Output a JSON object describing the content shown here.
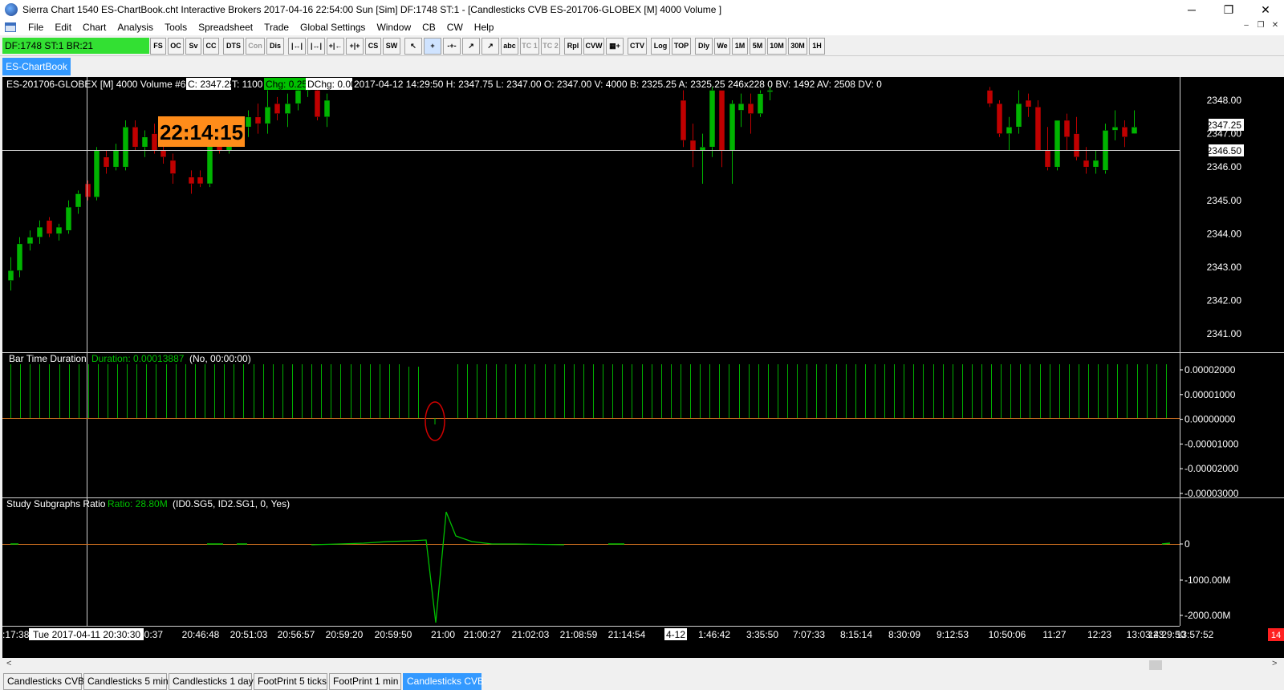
{
  "window": {
    "title": "Sierra Chart 1540 ES-ChartBook.cht  Interactive Brokers 2017-04-16  22:54:00 Sun [Sim]  DF:1748  ST:1 - [Candlesticks CVB  ES-201706-GLOBEX [M]  4000 Volume  ]",
    "controls": [
      "─",
      "❐",
      "✕"
    ]
  },
  "menu": [
    "File",
    "Edit",
    "Chart",
    "Analysis",
    "Tools",
    "Spreadsheet",
    "Trade",
    "Global Settings",
    "Window",
    "CB",
    "CW",
    "Help"
  ],
  "mdi_controls": [
    "–",
    "❐",
    "✕"
  ],
  "toolbar": {
    "status": "DF:1748  ST:1  BR:21",
    "buttons": [
      "FS",
      "OC",
      "Sv",
      "CC",
      "DTS",
      "Con",
      "Dis",
      "|↔|",
      "|↔|",
      "+|←",
      "+|+",
      "CS",
      "SW",
      "↖",
      "+",
      "-+-",
      "↗",
      "↗",
      "abc",
      "TC 1",
      "TC 2",
      "Rpl",
      "CVW",
      "▦+",
      "CTV",
      "Log",
      "TOP",
      "Dly",
      "We",
      "1M",
      "5M",
      "10M",
      "30M",
      "1H"
    ]
  },
  "chartbook_tab": "ES-ChartBook",
  "price_pane": {
    "header_symbol": "ES-201706-GLOBEX [M]  4000 Volume  #6",
    "header_close": "C: 2347.25",
    "header_t": "T: 1100",
    "header_chg": "Chg: 0.25",
    "header_dchg": "DChg: 0.00",
    "header_rest": "2017-04-12 14:29:50 H: 2347.75 L: 2347.00 O: 2347.00 V: 4000 B: 2325.25 A: 2325.25 246x228 0 BV: 1492 AV: 2508 DV: 0",
    "time_badge": "22:14:15",
    "current_price": "2347.25",
    "cursor_price": "2346.50",
    "y_labels": [
      "2348.00",
      "2347.00",
      "2346.00",
      "2345.00",
      "2344.00",
      "2343.00",
      "2342.00",
      "2341.00"
    ]
  },
  "duration_pane": {
    "title": "Bar Time Duration",
    "value": "Duration: 0.00013887",
    "params": "(No, 00:00:00)",
    "y_labels": [
      "0.00002000",
      "0.00001000",
      "0.00000000",
      "-0.00001000",
      "-0.00002000",
      "-0.00003000"
    ]
  },
  "ratio_pane": {
    "title": "Study Subgraphs Ratio",
    "value": "Ratio: 28.80M",
    "params": "(ID0.SG5, ID2.SG1, 0, Yes)",
    "y_labels": [
      "0",
      "-1000.00M",
      "-2000.00M"
    ]
  },
  "time_axis": {
    "labels": [
      ":17:38",
      "0:40:37",
      "20:46:48",
      "20:51:03",
      "20:56:57",
      "20:59:20",
      "20:59:50",
      "21:00",
      "21:00:27",
      "21:02:03",
      "21:08:59",
      "21:14:54",
      "4-12",
      "1:46:42",
      "3:35:50",
      "7:07:33",
      "8:15:14",
      "8:30:09",
      "9:12:53",
      "10:50:06",
      "11:27",
      "12:23",
      "13:03:23",
      "13:57:52",
      "14:29:50"
    ],
    "cursor_label": "Tue 2017-04-11  20:30:30",
    "corner_badge": "14"
  },
  "scroll": {
    "left_arrow": "<",
    "right_arrow": ">"
  },
  "bottom_tabs": [
    "Candlesticks CVB",
    "Candlesticks 5 min",
    "Candlesticks 1 day",
    "FootPrint 5 ticks",
    "FootPrint 1 min",
    "Candlesticks CVB"
  ],
  "colors": {
    "up": "#00b400",
    "down": "#c00000",
    "accent": "#3399ff",
    "badge": "#ff8c1a"
  },
  "chart_data": {
    "type": "candlestick",
    "candles": [
      {
        "o": 2342.6,
        "h": 2343.3,
        "l": 2342.3,
        "c": 2342.9
      },
      {
        "o": 2342.9,
        "h": 2343.9,
        "l": 2342.7,
        "c": 2343.7
      },
      {
        "o": 2343.7,
        "h": 2344.1,
        "l": 2343.5,
        "c": 2343.9
      },
      {
        "o": 2343.9,
        "h": 2344.4,
        "l": 2343.7,
        "c": 2344.2
      },
      {
        "o": 2344.4,
        "h": 2344.5,
        "l": 2343.9,
        "c": 2344.0
      },
      {
        "o": 2344.0,
        "h": 2344.3,
        "l": 2343.8,
        "c": 2344.2
      },
      {
        "o": 2344.1,
        "h": 2345.0,
        "l": 2344.0,
        "c": 2344.8
      },
      {
        "o": 2344.8,
        "h": 2345.3,
        "l": 2344.6,
        "c": 2345.2
      },
      {
        "o": 2345.5,
        "h": 2345.6,
        "l": 2345.0,
        "c": 2345.1
      },
      {
        "o": 2345.1,
        "h": 2346.6,
        "l": 2345.0,
        "c": 2346.5
      },
      {
        "o": 2346.3,
        "h": 2346.5,
        "l": 2345.8,
        "c": 2346.0
      },
      {
        "o": 2346.0,
        "h": 2346.7,
        "l": 2345.9,
        "c": 2346.5
      },
      {
        "o": 2346.0,
        "h": 2347.4,
        "l": 2345.9,
        "c": 2347.2
      },
      {
        "o": 2347.2,
        "h": 2347.4,
        "l": 2346.5,
        "c": 2346.6
      },
      {
        "o": 2346.6,
        "h": 2347.1,
        "l": 2346.3,
        "c": 2346.9
      },
      {
        "o": 2347.0,
        "h": 2347.3,
        "l": 2346.4,
        "c": 2346.5
      },
      {
        "o": 2346.5,
        "h": 2346.7,
        "l": 2346.1,
        "c": 2346.3
      },
      {
        "o": 2346.2,
        "h": 2346.4,
        "l": 2345.5,
        "c": 2345.8
      },
      {
        "o": 2345.7,
        "h": 2345.9,
        "l": 2345.2,
        "c": 2345.5
      },
      {
        "o": 2345.7,
        "h": 2345.9,
        "l": 2345.4,
        "c": 2345.5
      },
      {
        "o": 2345.5,
        "h": 2346.9,
        "l": 2345.4,
        "c": 2346.7
      },
      {
        "o": 2346.7,
        "h": 2347.0,
        "l": 2346.4,
        "c": 2346.5
      },
      {
        "o": 2346.5,
        "h": 2347.5,
        "l": 2346.4,
        "c": 2347.0
      },
      {
        "o": 2347.0,
        "h": 2347.5,
        "l": 2346.8,
        "c": 2347.2
      },
      {
        "o": 2347.2,
        "h": 2347.7,
        "l": 2346.9,
        "c": 2347.5
      },
      {
        "o": 2347.5,
        "h": 2347.9,
        "l": 2347.0,
        "c": 2347.3
      },
      {
        "o": 2347.3,
        "h": 2348.3,
        "l": 2347.0,
        "c": 2347.8
      },
      {
        "o": 2347.9,
        "h": 2348.1,
        "l": 2347.4,
        "c": 2347.6
      },
      {
        "o": 2347.6,
        "h": 2348.2,
        "l": 2347.2,
        "c": 2347.9
      },
      {
        "o": 2347.9,
        "h": 2348.5,
        "l": 2347.7,
        "c": 2348.3
      },
      {
        "o": 2348.3,
        "h": 2348.5,
        "l": 2348.1,
        "c": 2348.4
      },
      {
        "o": 2348.3,
        "h": 2348.4,
        "l": 2347.4,
        "c": 2347.5
      },
      {
        "o": 2347.5,
        "h": 2348.2,
        "l": 2347.2,
        "c": 2348.0
      },
      {
        "o": 2348.0,
        "h": 2348.3,
        "l": 2346.6,
        "c": 2346.8
      },
      {
        "o": 2346.8,
        "h": 2347.3,
        "l": 2346.0,
        "c": 2346.5
      },
      {
        "o": 2346.5,
        "h": 2347.0,
        "l": 2345.5,
        "c": 2346.6
      },
      {
        "o": 2346.6,
        "h": 2348.4,
        "l": 2346.3,
        "c": 2348.3
      },
      {
        "o": 2348.3,
        "h": 2348.3,
        "l": 2346.0,
        "c": 2346.5
      },
      {
        "o": 2346.5,
        "h": 2348.0,
        "l": 2345.5,
        "c": 2347.9
      },
      {
        "o": 2347.7,
        "h": 2348.2,
        "l": 2347.2,
        "c": 2347.9
      },
      {
        "o": 2347.9,
        "h": 2348.2,
        "l": 2347.0,
        "c": 2347.6
      },
      {
        "o": 2347.6,
        "h": 2348.3,
        "l": 2347.5,
        "c": 2348.2
      },
      {
        "o": 2348.3,
        "h": 2348.4,
        "l": 2348.0,
        "c": 2348.3
      },
      {
        "o": 2348.3,
        "h": 2348.4,
        "l": 2347.8,
        "c": 2347.9
      },
      {
        "o": 2347.9,
        "h": 2348.0,
        "l": 2346.9,
        "c": 2347.0
      },
      {
        "o": 2347.0,
        "h": 2347.5,
        "l": 2346.5,
        "c": 2347.2
      },
      {
        "o": 2347.2,
        "h": 2348.3,
        "l": 2347.0,
        "c": 2347.9
      },
      {
        "o": 2348.0,
        "h": 2348.2,
        "l": 2347.5,
        "c": 2347.8
      },
      {
        "o": 2347.8,
        "h": 2348.0,
        "l": 2346.5,
        "c": 2346.5
      },
      {
        "o": 2346.5,
        "h": 2347.2,
        "l": 2345.9,
        "c": 2346.0
      },
      {
        "o": 2346.0,
        "h": 2347.4,
        "l": 2345.9,
        "c": 2347.4
      },
      {
        "o": 2347.4,
        "h": 2347.6,
        "l": 2346.5,
        "c": 2346.9
      },
      {
        "o": 2347.0,
        "h": 2347.5,
        "l": 2346.2,
        "c": 2346.3
      },
      {
        "o": 2346.2,
        "h": 2346.6,
        "l": 2345.8,
        "c": 2346.0
      },
      {
        "o": 2346.0,
        "h": 2346.5,
        "l": 2345.8,
        "c": 2346.2
      },
      {
        "o": 2345.9,
        "h": 2347.3,
        "l": 2345.8,
        "c": 2347.1
      },
      {
        "o": 2347.1,
        "h": 2347.7,
        "l": 2346.8,
        "c": 2347.2
      },
      {
        "o": 2347.2,
        "h": 2347.4,
        "l": 2346.6,
        "c": 2346.9
      },
      {
        "o": 2347.0,
        "h": 2347.7,
        "l": 2347.0,
        "c": 2347.2
      }
    ]
  }
}
